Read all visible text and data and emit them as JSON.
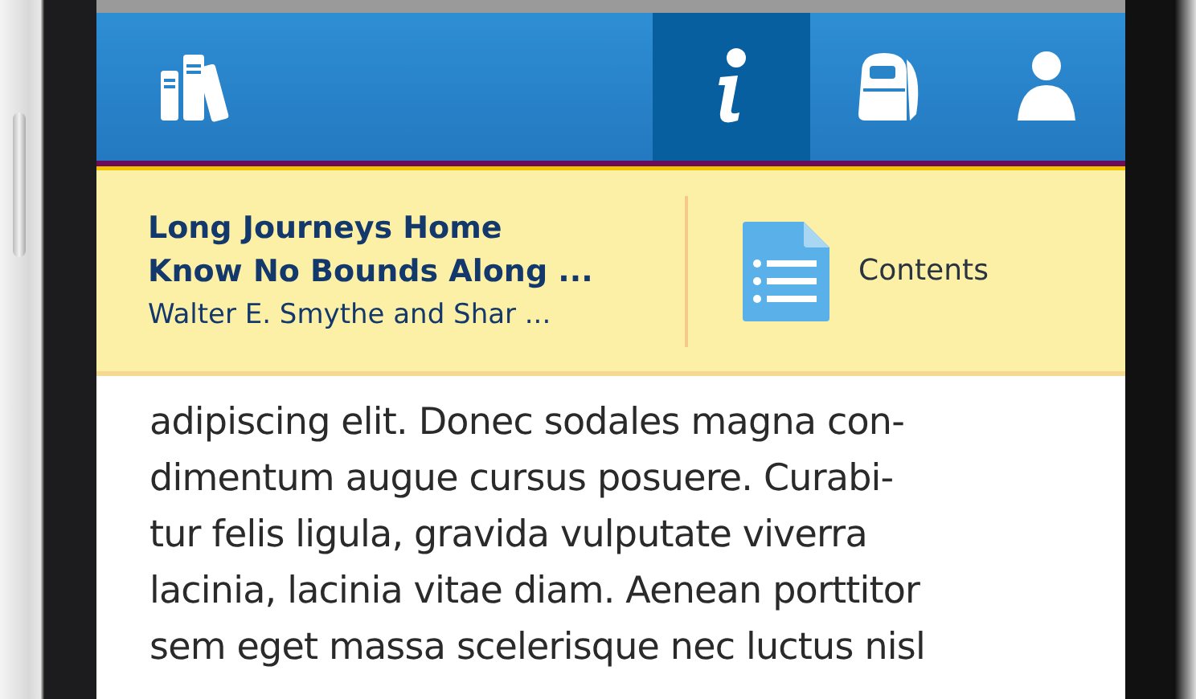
{
  "toolbar": {
    "tabs": [
      {
        "kind": "library",
        "selected": false
      },
      {
        "kind": "info",
        "selected": true
      },
      {
        "kind": "backpack",
        "selected": false
      },
      {
        "kind": "profile",
        "selected": false
      }
    ]
  },
  "book_header": {
    "title_lines": [
      "Long Journeys Home",
      "Know No Bounds Along ..."
    ],
    "authors": "Walter E. Smythe and Shar ...",
    "contents_label": "Contents"
  },
  "body_lines": [
    "adipiscing elit. Donec sodales magna con-",
    "dimentum augue cursus posuere. Curabi-",
    "tur felis ligula, gravida vulputate viverra",
    "lacinia, lacinia vitae diam. Aenean porttitor",
    "sem eget massa scelerisque nec luctus nisl"
  ]
}
